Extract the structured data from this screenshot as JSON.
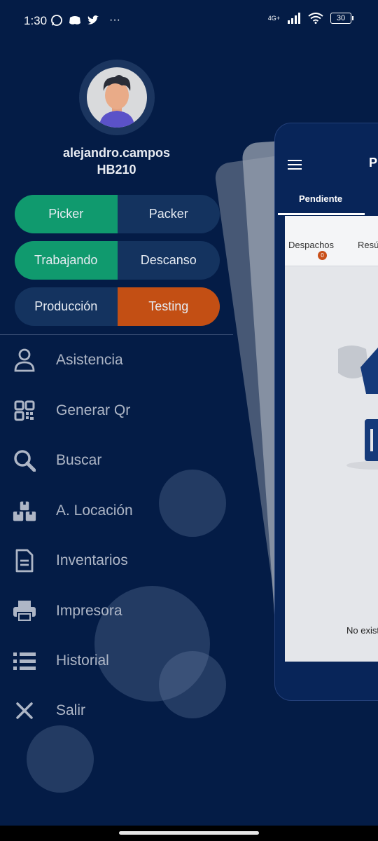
{
  "status_bar": {
    "time": "1:30",
    "network": "4G+",
    "battery": "30"
  },
  "background_app": {
    "title": "P",
    "tab_active": "Pendiente",
    "sub_tabs": [
      "Despachos",
      "Resú"
    ],
    "despachos_badge": "0",
    "empty_message": "No exist"
  },
  "profile": {
    "username": "alejandro.campos",
    "code": "HB210"
  },
  "toggles": {
    "role": {
      "left": "Picker",
      "right": "Packer",
      "active": "left"
    },
    "state": {
      "left": "Trabajando",
      "right": "Descanso",
      "active": "left"
    },
    "env": {
      "left": "Producción",
      "right": "Testing",
      "active": "right"
    }
  },
  "menu": [
    {
      "label": "Asistencia",
      "icon": "person-icon"
    },
    {
      "label": "Generar Qr",
      "icon": "qr-code-icon"
    },
    {
      "label": "Buscar",
      "icon": "search-icon"
    },
    {
      "label": "A. Locación",
      "icon": "boxes-icon"
    },
    {
      "label": "Inventarios",
      "icon": "document-icon"
    },
    {
      "label": "Impresora",
      "icon": "printer-icon"
    },
    {
      "label": "Historial",
      "icon": "list-icon"
    },
    {
      "label": "Salir",
      "icon": "close-icon"
    }
  ],
  "colors": {
    "background": "#041c46",
    "active_green": "#109a6e",
    "testing_orange": "#c34f14",
    "inactive_segment": "#14335f"
  }
}
